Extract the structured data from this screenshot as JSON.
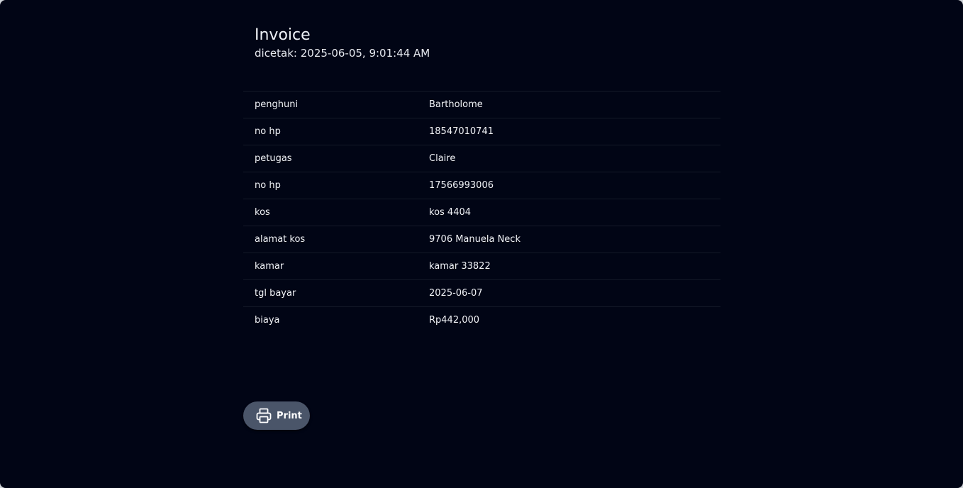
{
  "invoice": {
    "title": "Invoice",
    "printed": "dicetak: 2025-06-05, 9:01:44 AM"
  },
  "rows": [
    {
      "label": "penghuni",
      "value": "Bartholome"
    },
    {
      "label": "no hp",
      "value": "18547010741"
    },
    {
      "label": "petugas",
      "value": "Claire"
    },
    {
      "label": "no hp",
      "value": "17566993006"
    },
    {
      "label": "kos",
      "value": "kos 4404"
    },
    {
      "label": "alamat kos",
      "value": "9706 Manuela Neck"
    },
    {
      "label": "kamar",
      "value": "kamar 33822"
    },
    {
      "label": "tgl bayar",
      "value": "2025-06-07"
    },
    {
      "label": "biaya",
      "value": "Rp442,000"
    }
  ],
  "actions": {
    "print_label": "Print",
    "print_icon": "printer-icon"
  }
}
